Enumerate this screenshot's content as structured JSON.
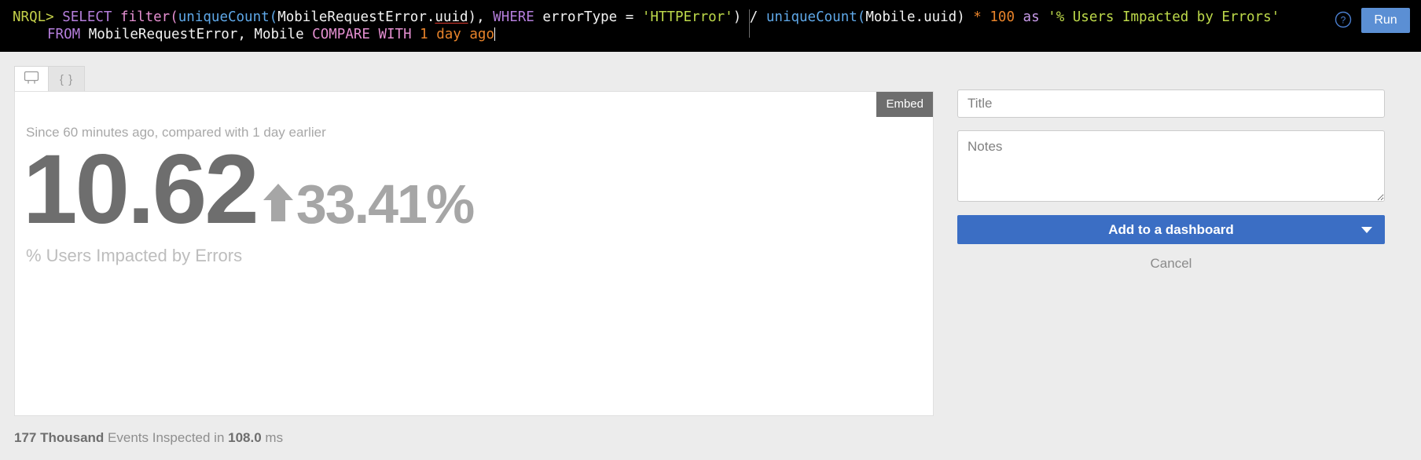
{
  "query_bar": {
    "prompt": "NRQL>",
    "line1": {
      "select": "SELECT",
      "filter_open": "filter(",
      "unique_count": "uniqueCount(",
      "event_field": "MobileRequestError.",
      "field_underlined": "uuid",
      "close_paren_comma": "), ",
      "where": "WHERE",
      "condition_field": " errorType = ",
      "string_value": "'HTTPError'",
      "close_paren": ")",
      "divide": " / ",
      "unique_count2": "uniqueCount(",
      "mobile_uuid": "Mobile.uuid",
      "close_paren2": ")",
      "multiply": " * ",
      "number": "100",
      "as": "as",
      "alias": "'% Users Impacted by Errors'"
    },
    "line2": {
      "from": "FROM",
      "sources": " MobileRequestError, Mobile ",
      "compare_with": "COMPARE WITH",
      "time_value": "1 day",
      "ago": "ago"
    },
    "help_icon": "question-circle-icon",
    "run_label": "Run"
  },
  "tabs": [
    {
      "id": "chart",
      "icon": "billboard-chart-icon",
      "label": "",
      "active": true
    },
    {
      "id": "json",
      "icon": "braces-icon",
      "label": "{ }",
      "active": false
    }
  ],
  "result": {
    "embed_label": "Embed",
    "since_line": "Since 60 minutes ago, compared with 1 day earlier",
    "value": "10.62",
    "trend_icon": "arrow-up-icon",
    "trend_direction": "up",
    "delta": "33.41%",
    "label": "% Users Impacted by Errors"
  },
  "side_panel": {
    "title_placeholder": "Title",
    "title_value": "",
    "notes_placeholder": "Notes",
    "notes_value": "",
    "add_dashboard_label": "Add to a dashboard",
    "dropdown_icon": "chevron-down-icon",
    "cancel_label": "Cancel"
  },
  "footer": {
    "events_count": "177 Thousand",
    "events_text": " Events Inspected in ",
    "duration": "108.0",
    "duration_unit": " ms"
  },
  "chart_data": {
    "type": "billboard",
    "title": "% Users Impacted by Errors",
    "subtitle": "Since 60 minutes ago, compared with 1 day earlier",
    "value": 10.62,
    "comparison_delta_percent": 33.41,
    "comparison_direction": "up",
    "unit": "%",
    "events_inspected": "177 Thousand",
    "query_duration_ms": 108.0
  },
  "colors": {
    "query_bar_bg": "#000000",
    "run_button": "#5b8fd4",
    "add_dashboard_button": "#3b6ec4",
    "embed_button": "#6e6e6e",
    "value_text": "#6e6e6e",
    "delta_text": "#a6a6a6",
    "page_bg": "#ececec"
  }
}
